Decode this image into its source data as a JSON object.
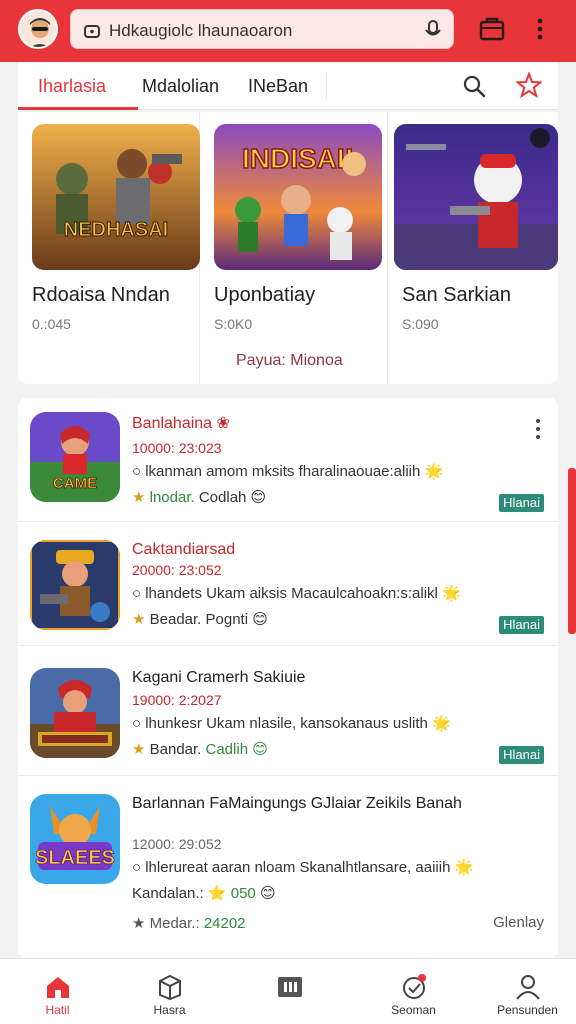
{
  "browser": {
    "url_text": "Hdkaugiolc lhaunaoaron"
  },
  "tabs": [
    {
      "label": "Iharlasia"
    },
    {
      "label": "Mdalolian"
    },
    {
      "label": "INeBan"
    }
  ],
  "featured": [
    {
      "title": "Rdoaisa Nndan",
      "sub": "0.:045",
      "badge": "NEDHASAI",
      "extra": ""
    },
    {
      "title": "Uponbatiay",
      "sub": "S:0K0",
      "badge": "INDISAI!",
      "extra": "Payua: Mionoa"
    },
    {
      "title": "San Sarkian",
      "sub": "S:090",
      "badge": "",
      "extra": ""
    }
  ],
  "list": [
    {
      "title": "Banlahaina ❀",
      "date": "10000: 23:023",
      "desc": "○ lkanman amom mksits fharalinaouae:aliih 🌟",
      "meta_a": "★ ",
      "meta_b": "lnodar.",
      "meta_c": " Codlah 😊",
      "tag": "Hlanai",
      "icon_text": "CAME"
    },
    {
      "title": "Caktandiarsad",
      "date": "20000: 23:052",
      "desc": "○ lhandets Ukam aiksis Macaulcahoakn:s:alikl 🌟",
      "meta_a": "★ ",
      "meta_b": "Beadar.",
      "meta_c": " Pognti 😊",
      "tag": "Hlanai",
      "icon_text": ""
    },
    {
      "title": "Kagani Cramerh Sakiuie",
      "date": "19000: 2:2027",
      "desc": "○ lhunkesr Ukam nlasile, kansokanaus uslith 🌟",
      "meta_a": "★ ",
      "meta_b": "Bandar.",
      "meta_c": " Cadlih 😊",
      "tag": "Hlanai",
      "icon_text": ""
    },
    {
      "title": "Barlannan FaMaingungs GJlaiar Zeikils Banah",
      "date": "12000: 29:052",
      "desc": "○ lhlerureat aaran nloam Skanalhtlansare, aaiiih 🌟",
      "meta_a": "Kandalan.: ",
      "meta_b": "⭐ 050",
      "meta_c": " 😊",
      "meta2_a": "★ Medar.: ",
      "meta2_b": "24202",
      "status": "Glenlay",
      "icon_text": "SLAEES"
    }
  ],
  "bottom_nav": [
    {
      "label": "Hatil"
    },
    {
      "label": "Hasra"
    },
    {
      "label": ""
    },
    {
      "label": "Seoman"
    },
    {
      "label": "Pensunden"
    }
  ],
  "colors": {
    "brand": "#e8353a",
    "tag": "#2d8c78"
  }
}
